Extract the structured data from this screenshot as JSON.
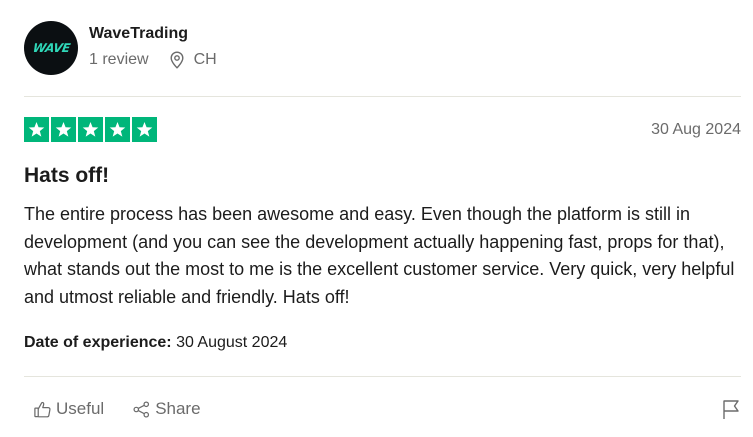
{
  "reviewer": {
    "avatar_text": "WAVE",
    "name": "WaveTrading",
    "review_count": "1 review",
    "country": "CH"
  },
  "review": {
    "rating": 5,
    "date": "30 Aug 2024",
    "title": "Hats off!",
    "body": "The entire process has been awesome and easy. Even though the platform is still in development (and you can see the development actually happening fast, props for that), what stands out the most to me is the excellent customer service. Very quick, very helpful and utmost reliable and friendly. Hats off!",
    "experience_label": "Date of experience:",
    "experience_date": "30 August 2024"
  },
  "actions": {
    "useful_label": "Useful",
    "share_label": "Share"
  },
  "icons": {
    "location": "map-pin-icon",
    "star": "star-icon",
    "useful": "thumbs-up-icon",
    "share": "share-icon",
    "report": "flag-icon"
  },
  "colors": {
    "star_green": "#00b67a",
    "avatar_bg": "#0b0f12",
    "avatar_text": "#2fd7b8",
    "muted_text": "#6b6b6b",
    "divider": "#e5e5dd"
  }
}
